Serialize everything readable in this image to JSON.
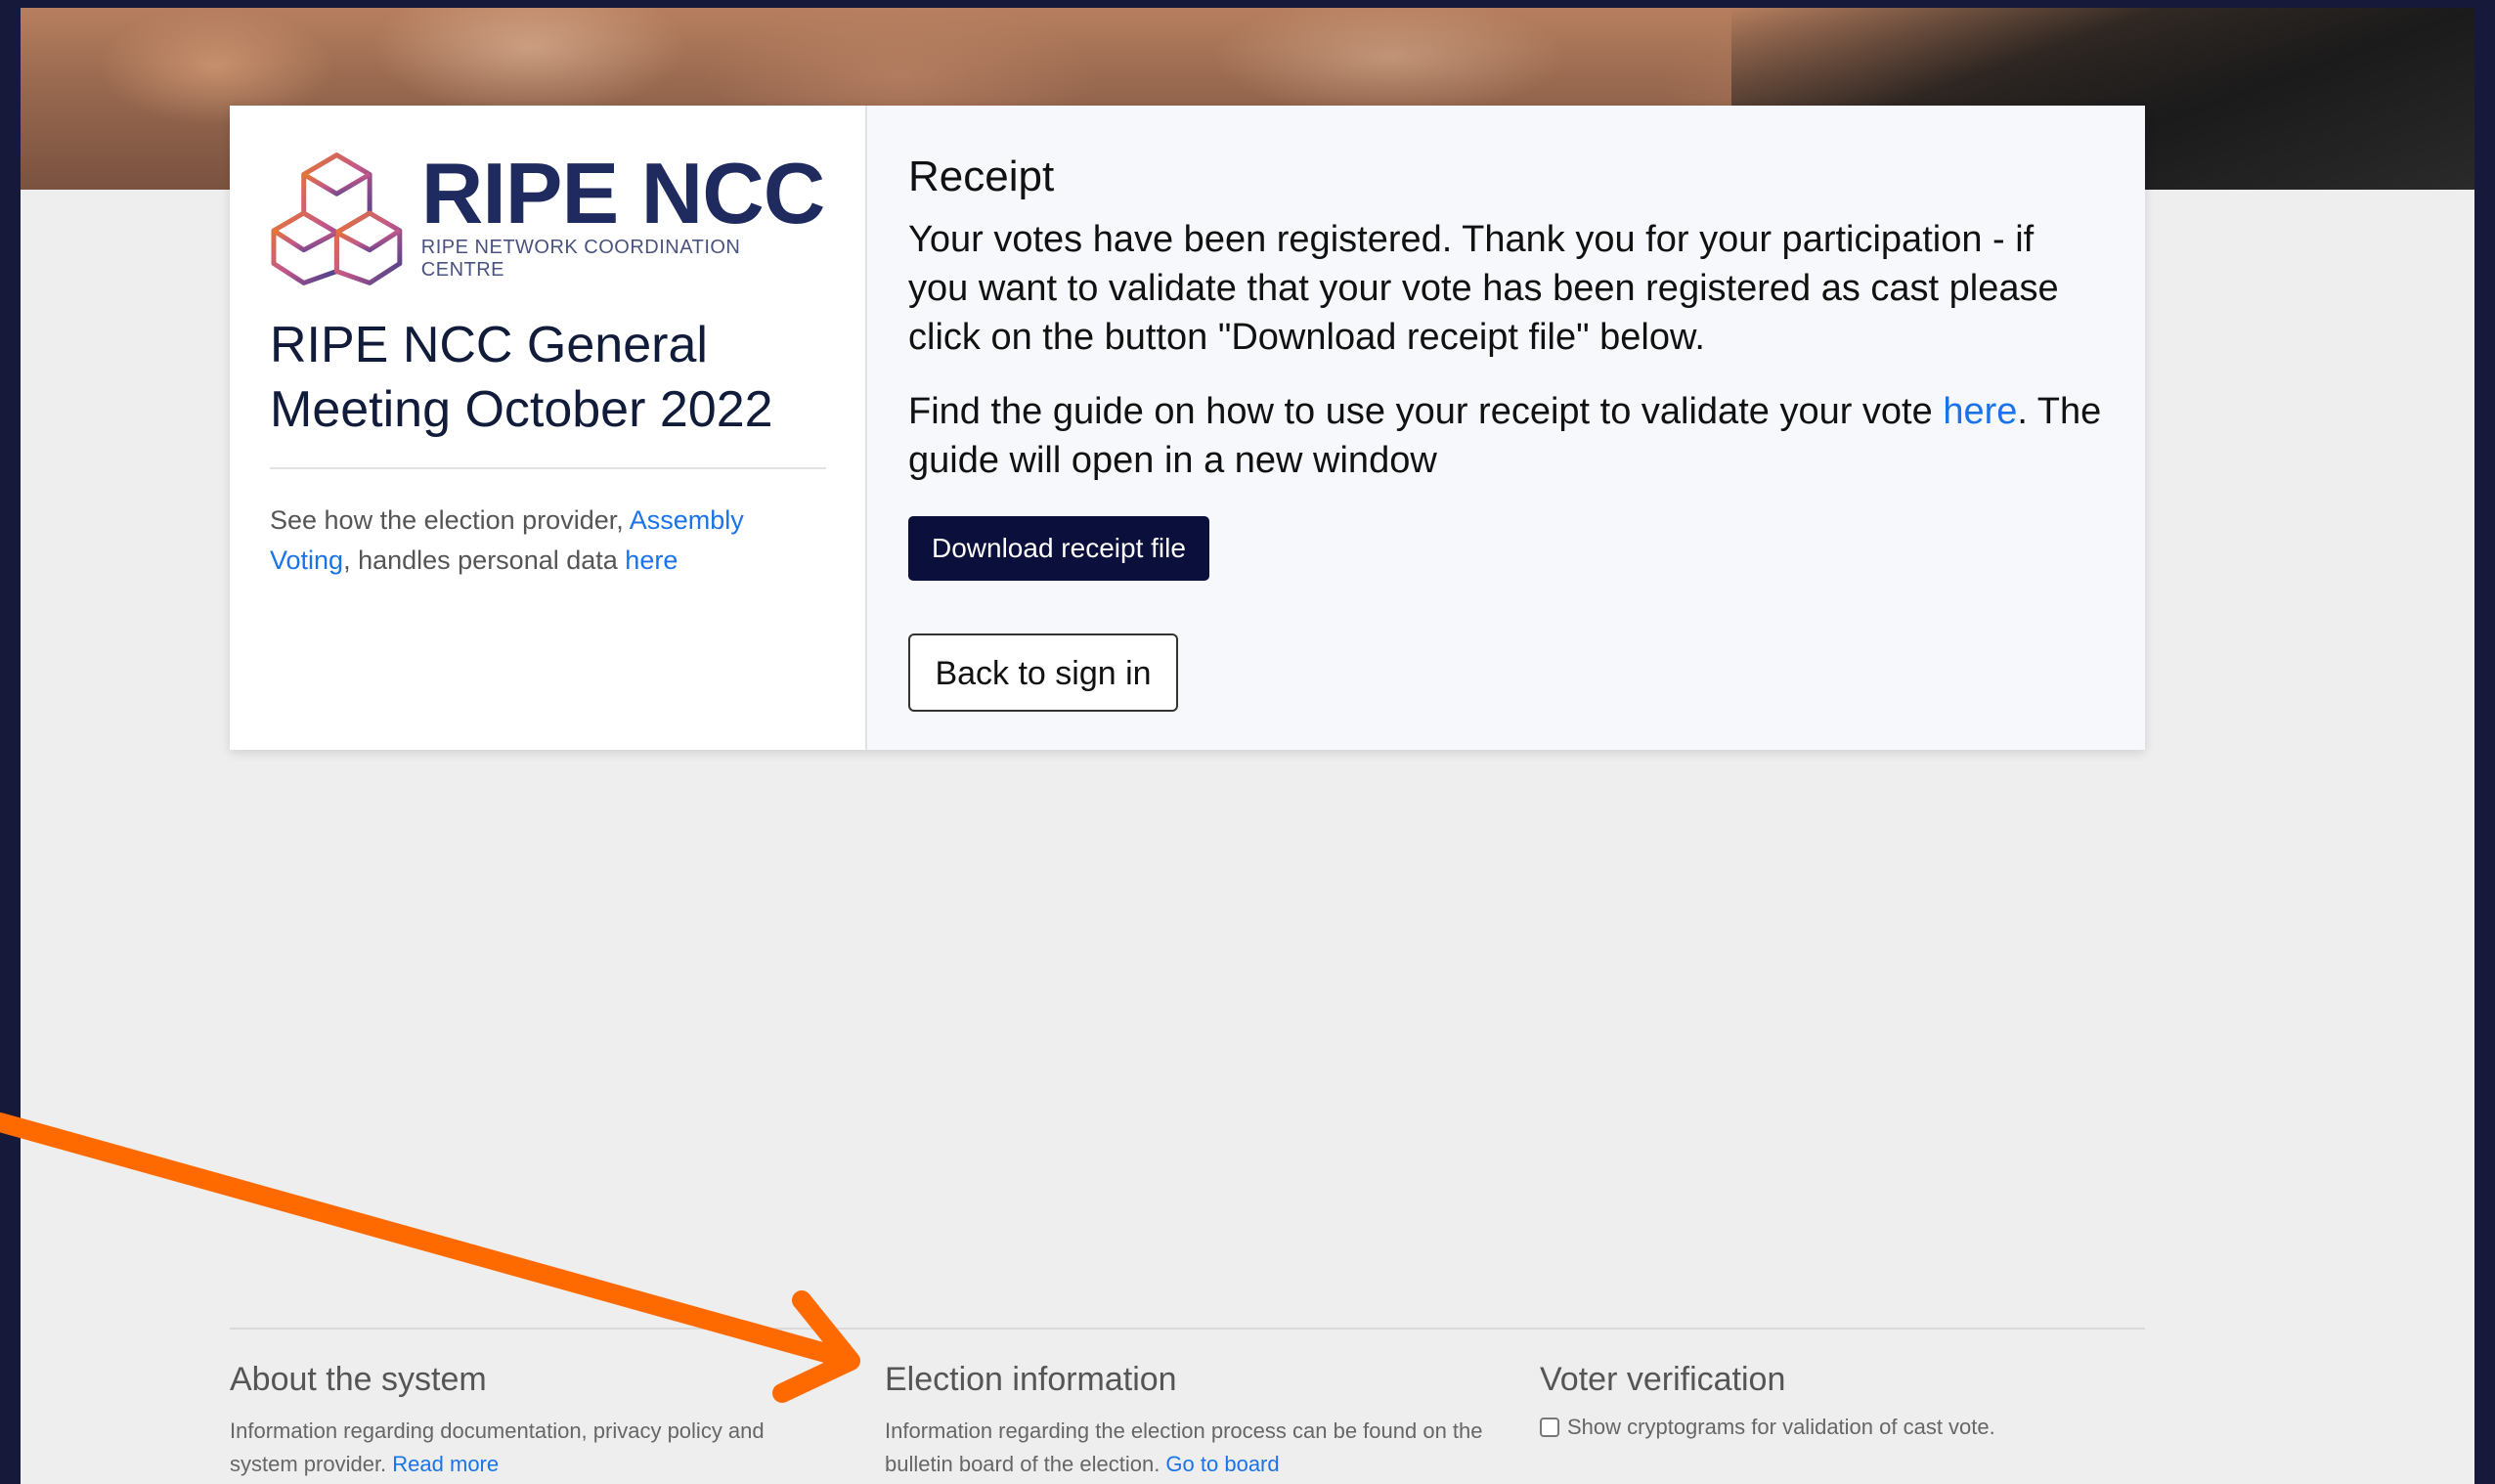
{
  "logo": {
    "main": "RIPE NCC",
    "sub": "RIPE NETWORK COORDINATION CENTRE"
  },
  "event": {
    "title": "RIPE NCC General Meeting October 2022"
  },
  "privacy": {
    "prefix": "See how the election provider, ",
    "provider_link": "Assembly Voting",
    "middle": ", handles personal data ",
    "here_link": "here"
  },
  "receipt": {
    "title": "Receipt",
    "message": "Your votes have been registered. Thank you for your participation - if you want to validate that your vote has been registered as cast please click on the button \"Download receipt file\" below.",
    "guide_prefix": "Find the guide on how to use your receipt to validate your vote ",
    "guide_link": "here",
    "guide_suffix": ". The guide will open in a new window",
    "download_label": "Download receipt file",
    "back_label": "Back to sign in"
  },
  "footer": {
    "about": {
      "title": "About the system",
      "text": "Information regarding documentation, privacy policy and system provider. ",
      "link": "Read more"
    },
    "election": {
      "title": "Election information",
      "text": "Information regarding the election process can be found on the bulletin board of the election. ",
      "link": "Go to board"
    },
    "verification": {
      "title": "Voter verification",
      "checkbox_label": "Show cryptograms for validation of cast vote."
    }
  },
  "colors": {
    "brand_navy": "#1f2b5e",
    "button_dark": "#0a0f3c",
    "link_blue": "#1a73e8",
    "annotation_arrow": "#ff6a00"
  }
}
